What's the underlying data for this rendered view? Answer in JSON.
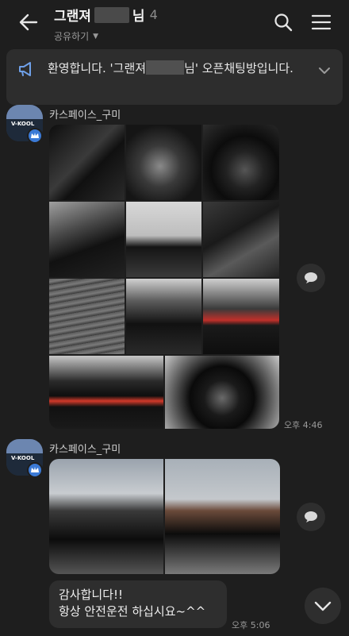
{
  "header": {
    "title_prefix": "그랜져",
    "title_suffix": "님",
    "member_count": "4",
    "subtitle": "공유하기"
  },
  "notice": {
    "text_before": "환영합니다. '그랜져",
    "text_after": "님' 오픈채팅방입니다."
  },
  "messages": [
    {
      "sender": "카스페이스_구미",
      "type": "photos",
      "photo_count": 11,
      "time": "오후 4:46"
    },
    {
      "sender": "카스페이스_구미",
      "type": "photos",
      "photo_count": 2
    },
    {
      "sender": "카스페이스_구미",
      "type": "text",
      "lines": [
        "감사합니다!!",
        "항상 안전운전 하십시요~^^"
      ],
      "time": "오후 5:06"
    }
  ],
  "brand": {
    "sign": "V-KOOL"
  },
  "colors": {
    "background": "#1e1e1e",
    "bubble": "#2e2e2e",
    "notice": "#2d2d2d",
    "crown": "#3b7ad6"
  },
  "icons": [
    "back-arrow-icon",
    "search-icon",
    "menu-icon",
    "megaphone-icon",
    "chevron-down-icon",
    "crown-icon",
    "speech-bubble-icon"
  ]
}
